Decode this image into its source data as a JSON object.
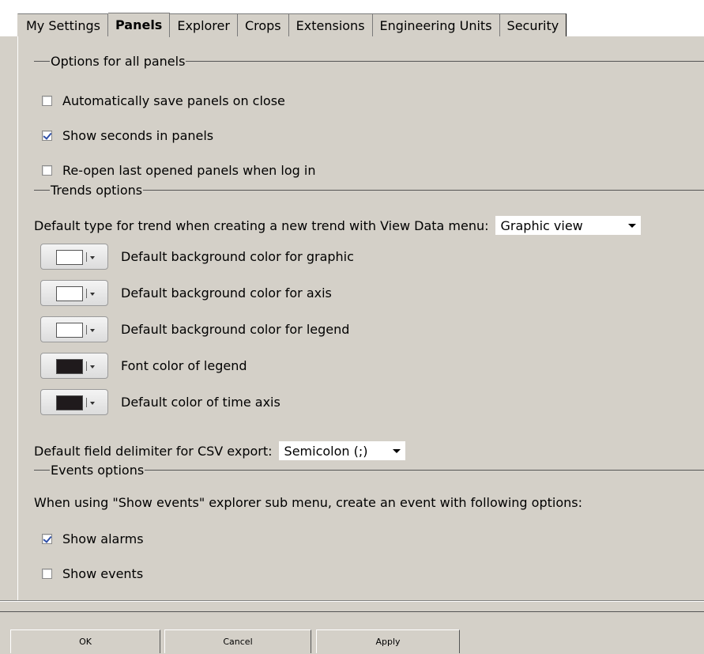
{
  "tabs": [
    {
      "label": "My Settings",
      "active": false
    },
    {
      "label": "Panels",
      "active": true
    },
    {
      "label": "Explorer",
      "active": false
    },
    {
      "label": "Crops",
      "active": false
    },
    {
      "label": "Extensions",
      "active": false
    },
    {
      "label": "Engineering Units",
      "active": false
    },
    {
      "label": "Security",
      "active": false
    }
  ],
  "groups": {
    "panels": {
      "title": "Options for all panels",
      "auto_save": {
        "label": "Automatically save panels on close",
        "checked": false
      },
      "show_seconds": {
        "label": "Show seconds in panels",
        "checked": true
      },
      "reopen_last": {
        "label": "Re-open last opened panels when log in",
        "checked": false
      }
    },
    "trends": {
      "title": "Trends options",
      "default_type_label": "Default type for trend when creating a new trend with View Data menu:",
      "default_type_value": "Graphic view",
      "colors": [
        {
          "label": "Default background color for graphic",
          "color": "#ffffff"
        },
        {
          "label": "Default background color for axis",
          "color": "#ffffff"
        },
        {
          "label": "Default background color for legend",
          "color": "#ffffff"
        },
        {
          "label": "Font color of legend",
          "color": "#1f1a1c"
        },
        {
          "label": "Default color of time axis",
          "color": "#1f1a1c"
        }
      ],
      "csv_label": "Default field delimiter for CSV export:",
      "csv_value": "Semicolon (;)"
    },
    "events": {
      "title": "Events options",
      "description": "When using \"Show events\" explorer sub menu, create an event with following options:",
      "show_alarms": {
        "label": "Show alarms",
        "checked": true
      },
      "show_events": {
        "label": "Show events",
        "checked": false
      }
    }
  },
  "buttons": {
    "ok": "OK",
    "cancel": "Cancel",
    "apply": "Apply"
  }
}
